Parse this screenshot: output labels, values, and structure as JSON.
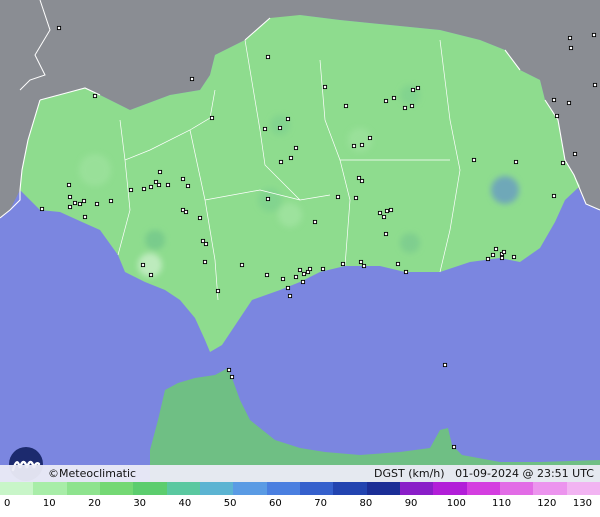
{
  "info_bar": {
    "brand": "©Meteoclimatic",
    "variable": "DGST (km/h)",
    "timestamp": "01-09-2024 @ 23:51 UTC"
  },
  "legend": {
    "ticks": [
      "0",
      "10",
      "20",
      "30",
      "40",
      "50",
      "60",
      "70",
      "80",
      "90",
      "100",
      "110",
      "120",
      "130"
    ],
    "colors": [
      "#c8f5c8",
      "#a8eda8",
      "#8ee38e",
      "#74d874",
      "#5ccd6e",
      "#5ac8a0",
      "#5cb4d2",
      "#5a9be4",
      "#4a7fe0",
      "#3560cc",
      "#2244b0",
      "#1b2e96",
      "#8a1ec8",
      "#b21ed8",
      "#d43ee0",
      "#e26ce6",
      "#ec94ee",
      "#f2b4f2"
    ]
  },
  "map": {
    "colors": {
      "sea": "#7b86e0",
      "land_outside": "#8a8d93",
      "andalusia": "#8edc8e",
      "morocco": "#6fbf84",
      "borders": "#ffffff"
    },
    "stations": [
      [
        59,
        28
      ],
      [
        268,
        57
      ],
      [
        325,
        87
      ],
      [
        192,
        79
      ],
      [
        95,
        96
      ],
      [
        212,
        118
      ],
      [
        265,
        129
      ],
      [
        288,
        119
      ],
      [
        280,
        128
      ],
      [
        386,
        101
      ],
      [
        394,
        98
      ],
      [
        413,
        90
      ],
      [
        418,
        88
      ],
      [
        412,
        106
      ],
      [
        405,
        108
      ],
      [
        346,
        106
      ],
      [
        370,
        138
      ],
      [
        362,
        145
      ],
      [
        354,
        146
      ],
      [
        474,
        160
      ],
      [
        516,
        162
      ],
      [
        296,
        148
      ],
      [
        291,
        158
      ],
      [
        281,
        162
      ],
      [
        359,
        178
      ],
      [
        362,
        181
      ],
      [
        356,
        198
      ],
      [
        268,
        199
      ],
      [
        188,
        186
      ],
      [
        183,
        179
      ],
      [
        168,
        185
      ],
      [
        160,
        172
      ],
      [
        156,
        182
      ],
      [
        159,
        185
      ],
      [
        151,
        187
      ],
      [
        144,
        189
      ],
      [
        131,
        190
      ],
      [
        69,
        185
      ],
      [
        70,
        197
      ],
      [
        75,
        203
      ],
      [
        70,
        207
      ],
      [
        80,
        204
      ],
      [
        84,
        201
      ],
      [
        85,
        217
      ],
      [
        97,
        204
      ],
      [
        111,
        201
      ],
      [
        183,
        210
      ],
      [
        186,
        212
      ],
      [
        200,
        218
      ],
      [
        203,
        241
      ],
      [
        206,
        244
      ],
      [
        205,
        262
      ],
      [
        143,
        265
      ],
      [
        151,
        275
      ],
      [
        242,
        265
      ],
      [
        218,
        291
      ],
      [
        267,
        275
      ],
      [
        300,
        270
      ],
      [
        296,
        277
      ],
      [
        304,
        274
      ],
      [
        308,
        272
      ],
      [
        310,
        269
      ],
      [
        323,
        269
      ],
      [
        283,
        279
      ],
      [
        288,
        288
      ],
      [
        290,
        296
      ],
      [
        303,
        282
      ],
      [
        343,
        264
      ],
      [
        361,
        262
      ],
      [
        364,
        266
      ],
      [
        398,
        264
      ],
      [
        406,
        272
      ],
      [
        380,
        213
      ],
      [
        387,
        211
      ],
      [
        384,
        217
      ],
      [
        391,
        210
      ],
      [
        386,
        234
      ],
      [
        315,
        222
      ],
      [
        338,
        197
      ],
      [
        496,
        249
      ],
      [
        502,
        254
      ],
      [
        514,
        257
      ],
      [
        504,
        252
      ],
      [
        502,
        258
      ],
      [
        493,
        255
      ],
      [
        488,
        259
      ],
      [
        554,
        196
      ],
      [
        229,
        370
      ],
      [
        232,
        377
      ],
      [
        445,
        365
      ],
      [
        454,
        447
      ],
      [
        570,
        38
      ],
      [
        571,
        48
      ],
      [
        594,
        35
      ],
      [
        595,
        85
      ],
      [
        554,
        100
      ],
      [
        569,
        103
      ],
      [
        557,
        116
      ],
      [
        575,
        154
      ],
      [
        563,
        163
      ],
      [
        42,
        209
      ]
    ]
  }
}
